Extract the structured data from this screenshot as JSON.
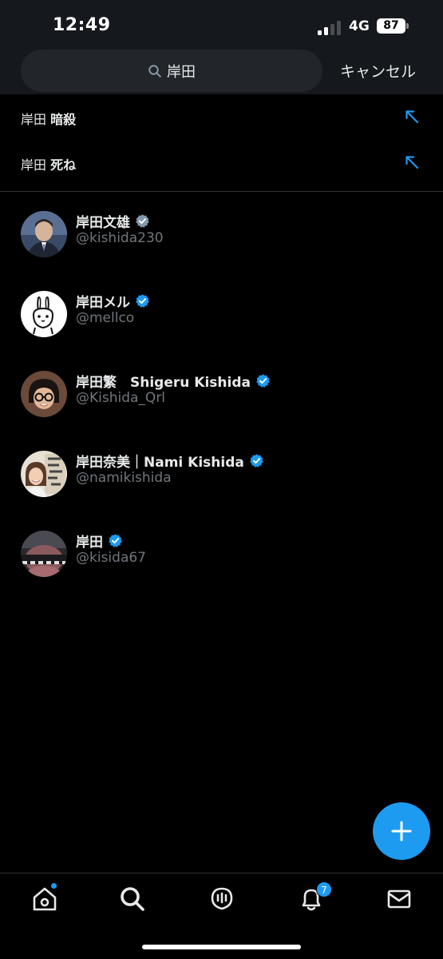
{
  "status_bar": {
    "time": "12:49",
    "network": "4G",
    "battery": "87",
    "signal_strength": 0.5
  },
  "search": {
    "query": "岸田",
    "cancel_label": "キャンセル"
  },
  "suggestions": [
    {
      "prefix": "岸田",
      "suffix": "暗殺"
    },
    {
      "prefix": "岸田",
      "suffix": "死ね"
    }
  ],
  "users": [
    {
      "name": "岸田文雄",
      "handle": "@kishida230",
      "verified": "gray"
    },
    {
      "name": "岸田メル",
      "handle": "@mellco",
      "verified": "blue"
    },
    {
      "name": "岸田繁　Shigeru Kishida",
      "handle": "@Kishida_Qrl",
      "verified": "blue"
    },
    {
      "name": "岸田奈美｜Nami Kishida",
      "handle": "@namikishida",
      "verified": "blue"
    },
    {
      "name": "岸田",
      "handle": "@kisida67",
      "verified": "blue"
    }
  ],
  "tab_bar": {
    "notifications_count": "7"
  },
  "icons": [
    "search-icon",
    "arrow-up-left-icon",
    "verified-icon",
    "plus-icon",
    "home-icon",
    "explore-icon",
    "spaces-icon",
    "bell-icon",
    "mail-icon"
  ],
  "colors": {
    "accent": "#1d9bf0",
    "verified_gray": "#829aab",
    "background": "#000000",
    "header": "#15181c"
  }
}
